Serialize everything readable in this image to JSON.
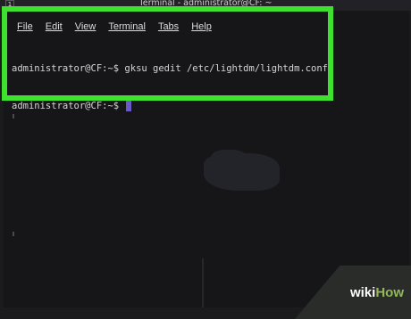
{
  "window": {
    "workspace": "1",
    "title": "Terminal - administrator@CF: ~"
  },
  "menu": {
    "file": "File",
    "edit": "Edit",
    "view": "View",
    "terminal": "Terminal",
    "tabs": "Tabs",
    "help": "Help"
  },
  "terminal": {
    "line1": "administrator@CF:~$ gksu gedit /etc/lightdm/lightdm.conf",
    "line2": "administrator@CF:~$ "
  },
  "highlight": {
    "color": "#3ee12d"
  },
  "watermark": {
    "wiki": "wiki",
    "how": "How"
  }
}
